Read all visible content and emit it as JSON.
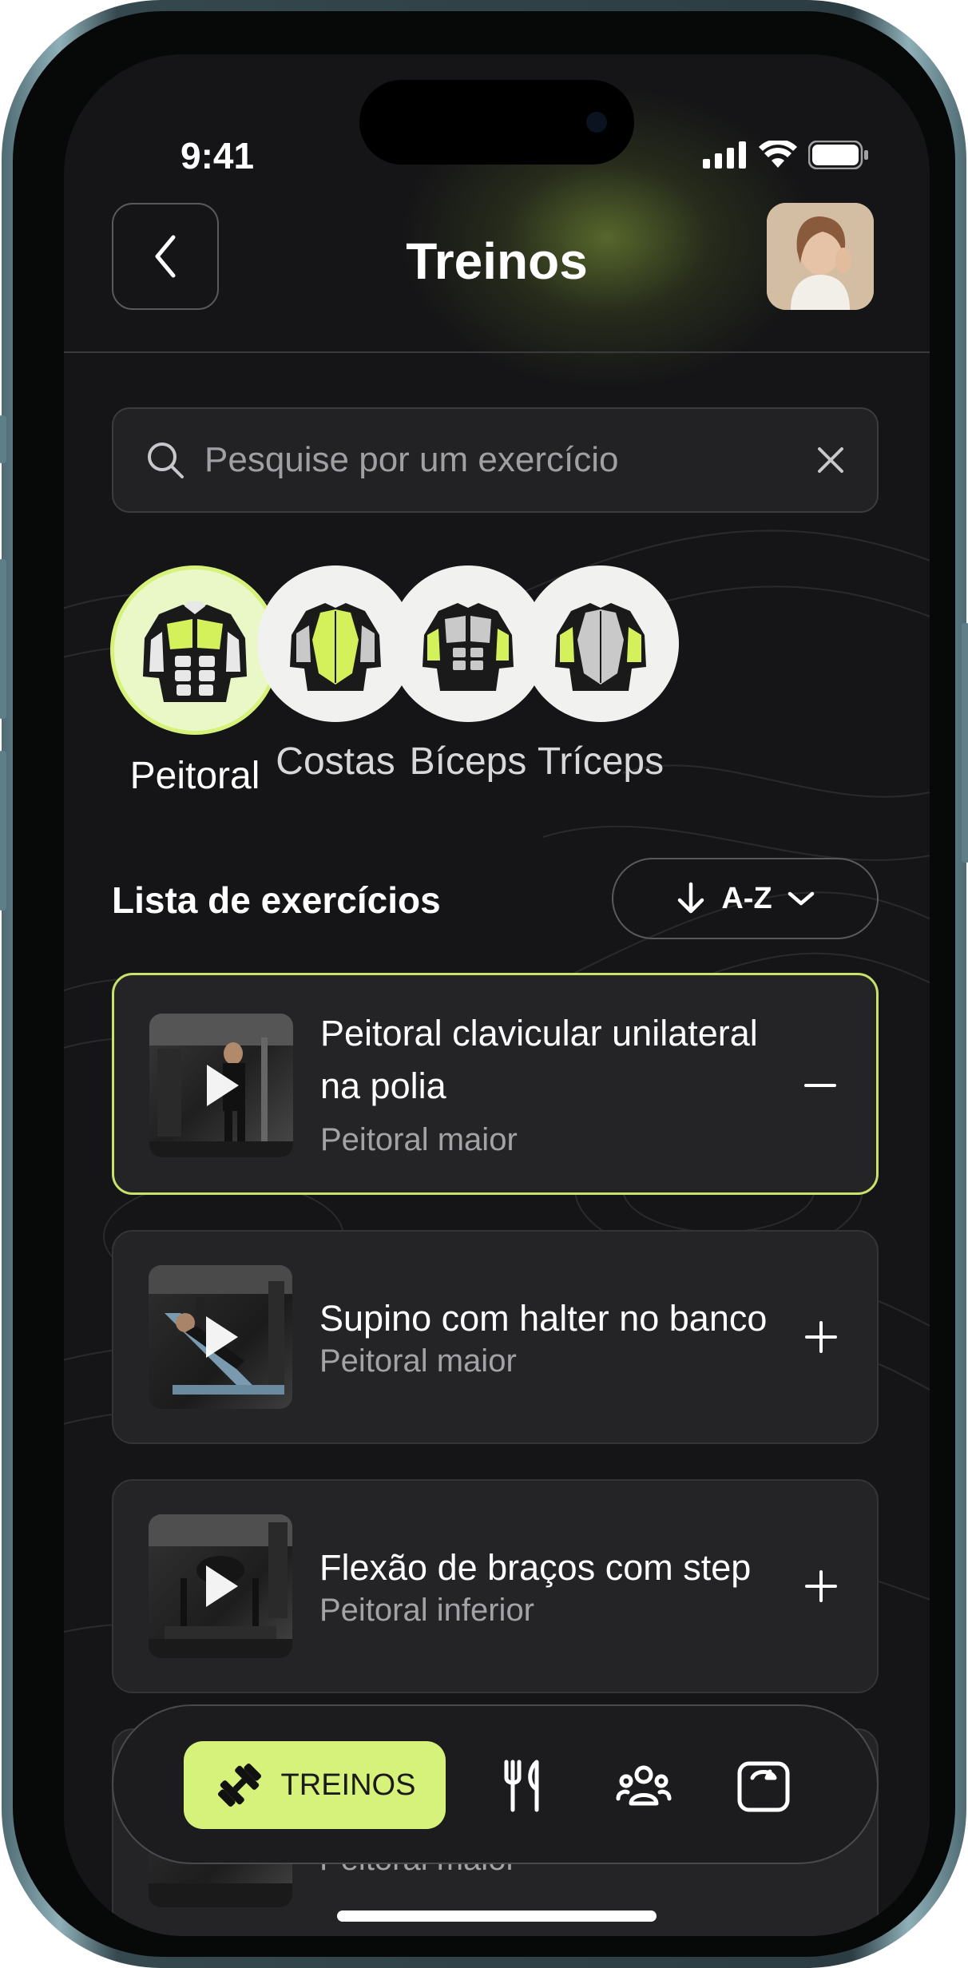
{
  "status_bar": {
    "time": "9:41"
  },
  "header": {
    "title": "Treinos"
  },
  "search": {
    "placeholder": "Pesquise por um exercício"
  },
  "categories": [
    {
      "label": "Peitoral",
      "active": true
    },
    {
      "label": "Costas",
      "active": false
    },
    {
      "label": "Bíceps",
      "active": false
    },
    {
      "label": "Tríceps",
      "active": false
    }
  ],
  "list": {
    "title": "Lista de exercícios",
    "sort_label": "A-Z"
  },
  "exercises": [
    {
      "title": "Peitoral clavicular unilateral na polia",
      "subtitle": "Peitoral maior",
      "action": "minus",
      "selected": true
    },
    {
      "title": "Supino com halter no banco",
      "subtitle": "Peitoral maior",
      "action": "plus",
      "selected": false
    },
    {
      "title": "Flexão de braços com step",
      "subtitle": "Peitoral inferior",
      "action": "plus",
      "selected": false
    },
    {
      "title": "",
      "subtitle": "Peitoral maior",
      "action": "plus",
      "selected": false
    }
  ],
  "nav": {
    "active_label": "TREINOS"
  },
  "colors": {
    "accent": "#d6f27a",
    "background": "#151517",
    "card": "#242427"
  }
}
